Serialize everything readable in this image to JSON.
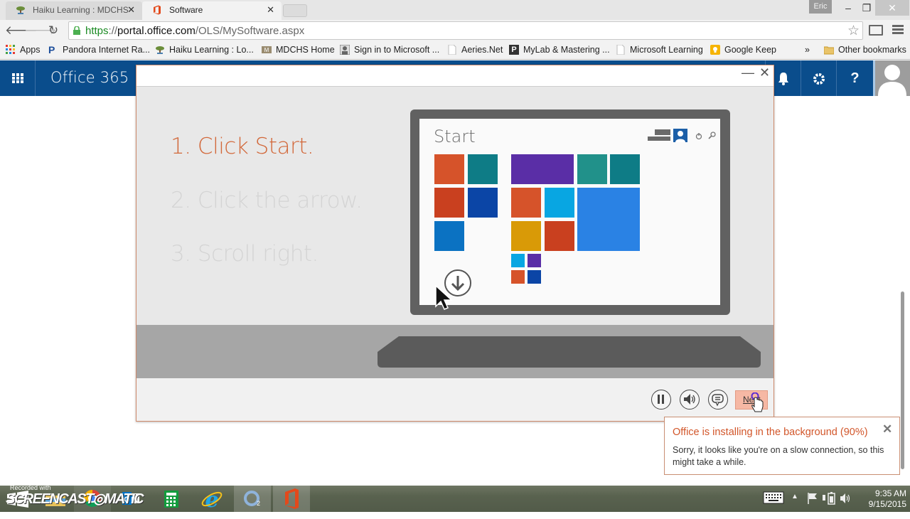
{
  "browser": {
    "tabs": [
      {
        "title": "Haiku Learning : MDCHS E",
        "active": false,
        "icon": "bonsai-icon"
      },
      {
        "title": "Software",
        "active": true,
        "icon": "office-icon"
      }
    ],
    "profile_name": "Eric",
    "url": {
      "scheme": "https",
      "separator": "://",
      "host": "portal.office.com",
      "path": "/OLS/MySoftware.aspx"
    },
    "bookmarks": [
      {
        "label": "Apps",
        "icon": "apps-grid-icon"
      },
      {
        "label": "Pandora Internet Ra...",
        "icon": "pandora-icon"
      },
      {
        "label": "Haiku Learning : Lo...",
        "icon": "bonsai-icon"
      },
      {
        "label": "MDCHS Home",
        "icon": "mdchs-icon"
      },
      {
        "label": "Sign in to Microsoft ...",
        "icon": "person-icon"
      },
      {
        "label": "Aeries.Net",
        "icon": "page-icon"
      },
      {
        "label": "MyLab & Mastering ...",
        "icon": "pearson-icon"
      },
      {
        "label": "Microsoft Learning",
        "icon": "page-icon"
      },
      {
        "label": "Google Keep",
        "icon": "keep-bulb-icon"
      }
    ],
    "overflow_label": "»",
    "other_bookmarks": "Other bookmarks"
  },
  "office_header": {
    "brand": "Office 365",
    "icons": [
      "bell-icon",
      "gear-icon",
      "help-icon"
    ],
    "help_glyph": "?"
  },
  "modal": {
    "steps": [
      {
        "text": "1. Click Start.",
        "active": true
      },
      {
        "text": "2. Click the arrow.",
        "active": false
      },
      {
        "text": "3. Scroll right.",
        "active": false
      }
    ],
    "illustration": {
      "screen_title": "Start",
      "tile_colors": {
        "orange": "#d6532a",
        "teal": "#0e7c86",
        "red": "#c9401f",
        "navy": "#0b45a6",
        "blue": "#0b72c2",
        "purple": "#5a2ea6",
        "teal_light": "#21918a",
        "cyan": "#08a6e2",
        "gold": "#d99a07",
        "sky": "#2a82e4"
      }
    },
    "controls": {
      "pause": "pause-icon",
      "volume": "volume-icon",
      "captions": "captions-icon",
      "next_label": "Next"
    }
  },
  "notification": {
    "title": "Office is installing in the background (90%)",
    "progress_percent": 90,
    "message": "Sorry, it looks like you're on a slow connection, so this might take a while.",
    "close_glyph": "✕"
  },
  "taskbar": {
    "watermark_top": "Recorded with",
    "watermark_brand": "SCREENCAST◎MATIC",
    "apps": [
      "start-icon",
      "file-explorer-icon",
      "chrome-icon",
      "outlook-icon",
      "calculator-icon",
      "internet-explorer-icon",
      "o2-app-icon",
      "office-icon"
    ],
    "time": "9:35 AM",
    "date": "9/15/2015"
  },
  "colors": {
    "office_blue": "#0a4d8c",
    "accent_orange": "#d2562a",
    "next_button": "#f6b8a4"
  }
}
